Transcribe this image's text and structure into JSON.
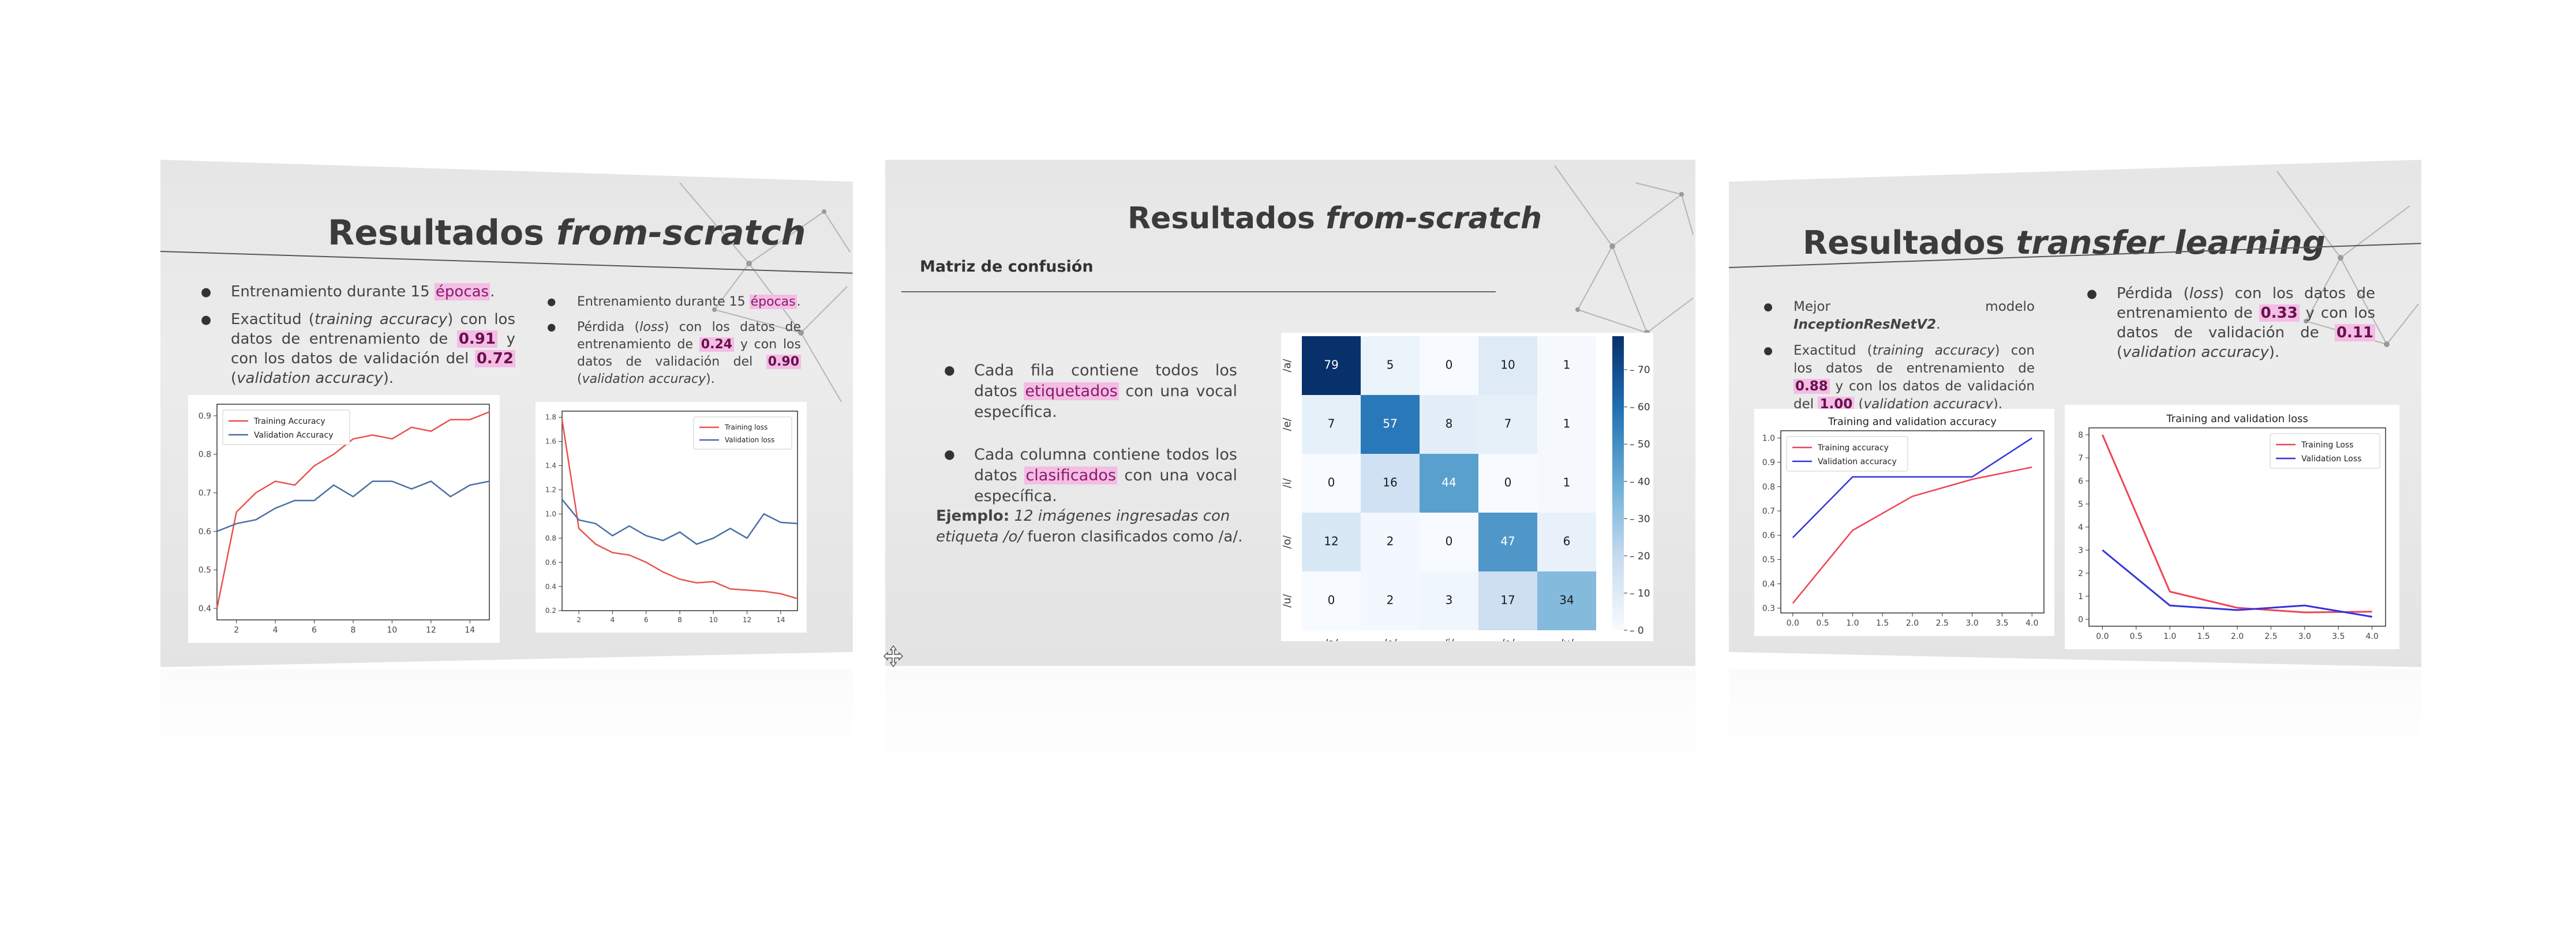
{
  "slides": {
    "left": {
      "title_plain": "Resultados ",
      "title_italic": "from-scratch",
      "col1": {
        "b1": "Entrenamiento durante 15 ",
        "b1_hl": "épocas",
        "b1_end": ".",
        "b2_a": "Exactitud (",
        "b2_it": "training accuracy",
        "b2_b": ") con los datos de entrenamiento de ",
        "b2_n1": "0.91",
        "b2_c": " y con los datos de validación del ",
        "b2_n2": "0.72",
        "b2_d": " (",
        "b2_it2": "validation accuracy",
        "b2_e": ")."
      },
      "col2": {
        "b1": "Entrenamiento durante 15 ",
        "b1_hl": "épocas",
        "b1_end": ".",
        "b2_a": "Pérdida (",
        "b2_it": "loss",
        "b2_b": ") con los datos de entrenamiento de ",
        "b2_n1": "0.24",
        "b2_c": " y con los datos de validación del ",
        "b2_n2": "0.90",
        "b2_d": " (",
        "b2_it2": "validation accuracy",
        "b2_e": ")."
      }
    },
    "center": {
      "title_plain": "Resultados ",
      "title_italic": "from-scratch",
      "subtitle": "Matriz de confusión",
      "b1_a": "Cada fila contiene todos los datos ",
      "b1_hl": "etiquetados",
      "b1_b": " con una vocal específica.",
      "b2_a": "Cada columna contiene todos los datos ",
      "b2_hl": "clasificados",
      "b2_b": " con una vocal específica.",
      "example_label": "Ejemplo:",
      "example_text_a": " ",
      "example_text_it": "12 imágenes ingresadas con etiqueta /o/",
      "example_text_b": " fueron clasificados como /a/."
    },
    "right": {
      "title_plain": "Resultados ",
      "title_italic": "transfer learning",
      "col1": {
        "b1_a": "Mejor modelo ",
        "b1_it": "InceptionResNetV2",
        "b1_end": ".",
        "b2_a": "Exactitud (",
        "b2_it": "training accuracy",
        "b2_b": ") con los datos de entrenamiento de ",
        "b2_n1": "0.88",
        "b2_c": " y con los datos de validación del ",
        "b2_n2": "1.00",
        "b2_d": " (",
        "b2_it2": "validation accuracy",
        "b2_e": ")."
      },
      "col2": {
        "b1_a": "Pérdida (",
        "b1_it": "loss",
        "b1_b": ") con los datos de entrenamiento de ",
        "b1_n1": "0.33",
        "b1_c": " y con los datos de validación de ",
        "b1_n2": "0.11",
        "b1_d": " (",
        "b1_it2": "validation accuracy",
        "b1_e": ")."
      }
    }
  },
  "colors": {
    "training": "#e8534f",
    "validation": "#4a6fa5",
    "tl_training": "#ee4455",
    "tl_validation": "#3333dd",
    "highlight": "#f3bde4",
    "heatmap_max": "#08306b",
    "heatmap_min": "#f7fbff"
  },
  "chart_data": [
    {
      "id": "scratch-accuracy",
      "type": "line",
      "title": "",
      "x": [
        1,
        2,
        3,
        4,
        5,
        6,
        7,
        8,
        9,
        10,
        11,
        12,
        13,
        14,
        15
      ],
      "xticks": [
        "2",
        "4",
        "6",
        "8",
        "10",
        "12",
        "14"
      ],
      "yticks": [
        "0.4",
        "0.5",
        "0.6",
        "0.7",
        "0.8",
        "0.9"
      ],
      "ylim": [
        0.37,
        0.93
      ],
      "legend_position": "top-left",
      "series": [
        {
          "name": "Training Accuracy",
          "values": [
            0.4,
            0.65,
            0.7,
            0.73,
            0.72,
            0.77,
            0.8,
            0.84,
            0.85,
            0.84,
            0.87,
            0.86,
            0.89,
            0.89,
            0.91
          ]
        },
        {
          "name": "Validation Accuracy",
          "values": [
            0.6,
            0.62,
            0.63,
            0.66,
            0.68,
            0.68,
            0.72,
            0.69,
            0.73,
            0.73,
            0.71,
            0.73,
            0.69,
            0.72,
            0.73
          ]
        }
      ]
    },
    {
      "id": "scratch-loss",
      "type": "line",
      "title": "",
      "x": [
        1,
        2,
        3,
        4,
        5,
        6,
        7,
        8,
        9,
        10,
        11,
        12,
        13,
        14,
        15
      ],
      "xticks": [
        "2",
        "4",
        "6",
        "8",
        "10",
        "12",
        "14"
      ],
      "yticks": [
        "0.2",
        "0.4",
        "0.6",
        "0.8",
        "1.0",
        "1.2",
        "1.4",
        "1.6",
        "1.8"
      ],
      "ylim": [
        0.2,
        1.85
      ],
      "legend_position": "top-right",
      "series": [
        {
          "name": "Training loss",
          "values": [
            1.78,
            0.88,
            0.75,
            0.68,
            0.66,
            0.6,
            0.52,
            0.46,
            0.43,
            0.44,
            0.38,
            0.37,
            0.36,
            0.34,
            0.3
          ]
        },
        {
          "name": "Validation loss",
          "values": [
            1.12,
            0.95,
            0.92,
            0.82,
            0.9,
            0.82,
            0.78,
            0.85,
            0.75,
            0.8,
            0.88,
            0.8,
            1.0,
            0.93,
            0.92
          ]
        }
      ]
    },
    {
      "id": "confusion-matrix",
      "type": "heatmap",
      "title": "",
      "rows": [
        "/a/",
        "/e/",
        "/i/",
        "/o/",
        "/u/"
      ],
      "cols": [
        "/a/",
        "/e/",
        "/i/",
        "/o/",
        "/u/"
      ],
      "values": [
        [
          79,
          5,
          0,
          10,
          1
        ],
        [
          7,
          57,
          8,
          7,
          1
        ],
        [
          0,
          16,
          44,
          0,
          1
        ],
        [
          12,
          2,
          0,
          47,
          6
        ],
        [
          0,
          2,
          3,
          17,
          34
        ]
      ],
      "colorbar_ticks": [
        "70",
        "60",
        "50",
        "40",
        "30",
        "20",
        "10",
        "0"
      ],
      "vmax": 79
    },
    {
      "id": "tl-accuracy",
      "type": "line",
      "title": "Training and validation accuracy",
      "x": [
        0,
        1,
        2,
        3,
        4
      ],
      "xticks": [
        "0.0",
        "0.5",
        "1.0",
        "1.5",
        "2.0",
        "2.5",
        "3.0",
        "3.5",
        "4.0"
      ],
      "yticks": [
        "0.3",
        "0.4",
        "0.5",
        "0.6",
        "0.7",
        "0.8",
        "0.9",
        "1.0"
      ],
      "ylim": [
        0.28,
        1.03
      ],
      "legend_position": "top-left",
      "series": [
        {
          "name": "Training accuracy",
          "values": [
            0.32,
            0.62,
            0.76,
            0.83,
            0.88
          ]
        },
        {
          "name": "Validation accuracy",
          "values": [
            0.59,
            0.84,
            0.84,
            0.84,
            1.0
          ]
        }
      ]
    },
    {
      "id": "tl-loss",
      "type": "line",
      "title": "Training and validation loss",
      "x": [
        0,
        1,
        2,
        3,
        4
      ],
      "xticks": [
        "0.0",
        "0.5",
        "1.0",
        "1.5",
        "2.0",
        "2.5",
        "3.0",
        "3.5",
        "4.0"
      ],
      "yticks": [
        "0",
        "1",
        "2",
        "3",
        "4",
        "5",
        "6",
        "7",
        "8"
      ],
      "ylim": [
        -0.3,
        8.3
      ],
      "legend_position": "top-right",
      "series": [
        {
          "name": "Training Loss",
          "values": [
            8.0,
            1.2,
            0.5,
            0.3,
            0.33
          ]
        },
        {
          "name": "Validation Loss",
          "values": [
            3.0,
            0.6,
            0.4,
            0.6,
            0.11
          ]
        }
      ]
    }
  ]
}
